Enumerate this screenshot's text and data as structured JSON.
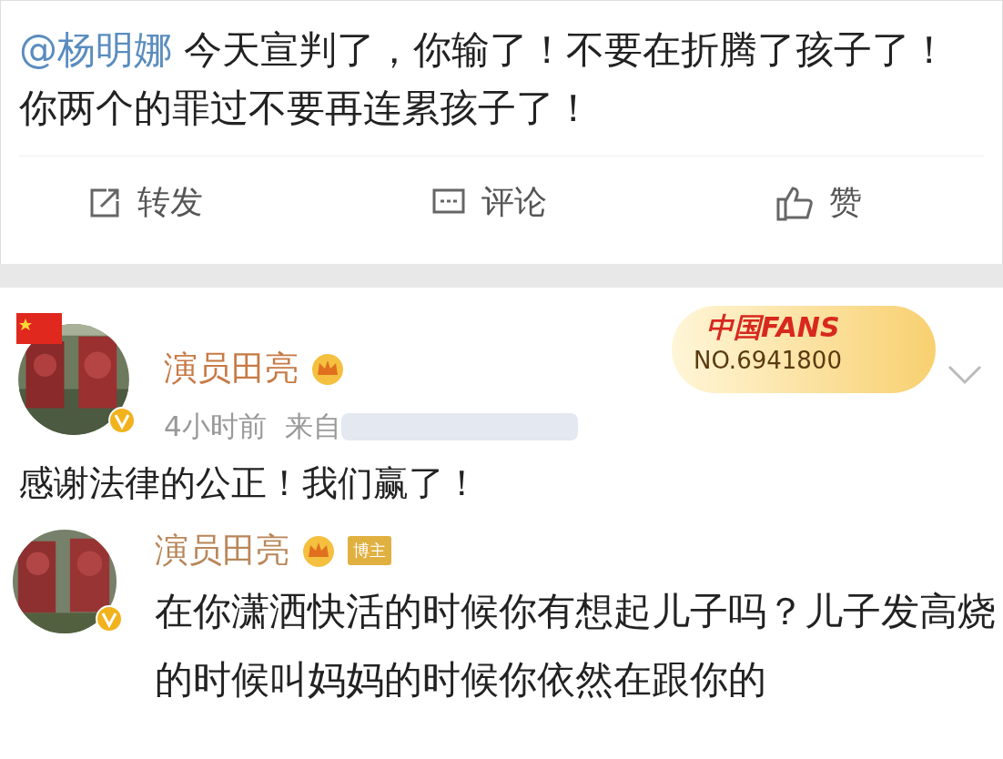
{
  "post": {
    "mention": "@杨明娜",
    "text": "今天宣判了，你输了！不要在折腾了孩子了！你两个的罪过不要再连累孩子了！",
    "actions": [
      {
        "kind": "repost",
        "label": "转发"
      },
      {
        "kind": "comment",
        "label": "评论"
      },
      {
        "kind": "like",
        "label": "赞"
      }
    ]
  },
  "reply": {
    "author": "演员田亮",
    "fan_badge": {
      "title": "中国FANS",
      "number": "NO.6941800"
    },
    "time": "4小时前",
    "source_prefix": "来自",
    "text": "感谢法律的公正！我们赢了！"
  },
  "comment": {
    "author": "演员田亮",
    "tag": "博主",
    "text": "在你潇洒快活的时候你有想起儿子吗？儿子发高烧的时候叫妈妈的时候你依然在跟你的"
  }
}
